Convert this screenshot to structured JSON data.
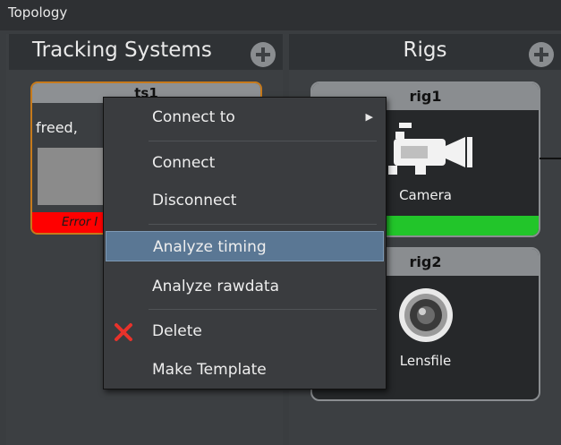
{
  "window": {
    "title": "Topology"
  },
  "panels": {
    "left": {
      "title": "Tracking Systems"
    },
    "right": {
      "title": "Rigs"
    }
  },
  "tracking_systems": [
    {
      "name": "ts1",
      "text": "freed,",
      "status": "Error I"
    }
  ],
  "rigs": [
    {
      "name": "rig1",
      "label": "Camera",
      "status_color": "#22c52a"
    },
    {
      "name": "rig2",
      "label": "Lensfile"
    }
  ],
  "context_menu": {
    "items": [
      {
        "label": "Connect to",
        "has_submenu": true
      },
      {
        "label": "Connect"
      },
      {
        "label": "Disconnect"
      },
      {
        "label": "Analyze timing",
        "highlighted": true
      },
      {
        "label": "Analyze rawdata"
      },
      {
        "label": "Delete",
        "icon": "delete-x-icon"
      },
      {
        "label": "Make Template"
      }
    ],
    "submenu_arrow": "▶"
  },
  "colors": {
    "accent_orange": "#c67a1c",
    "error_red": "#ff0000",
    "ok_green": "#22c52a",
    "highlight_blue": "#5a7794"
  }
}
